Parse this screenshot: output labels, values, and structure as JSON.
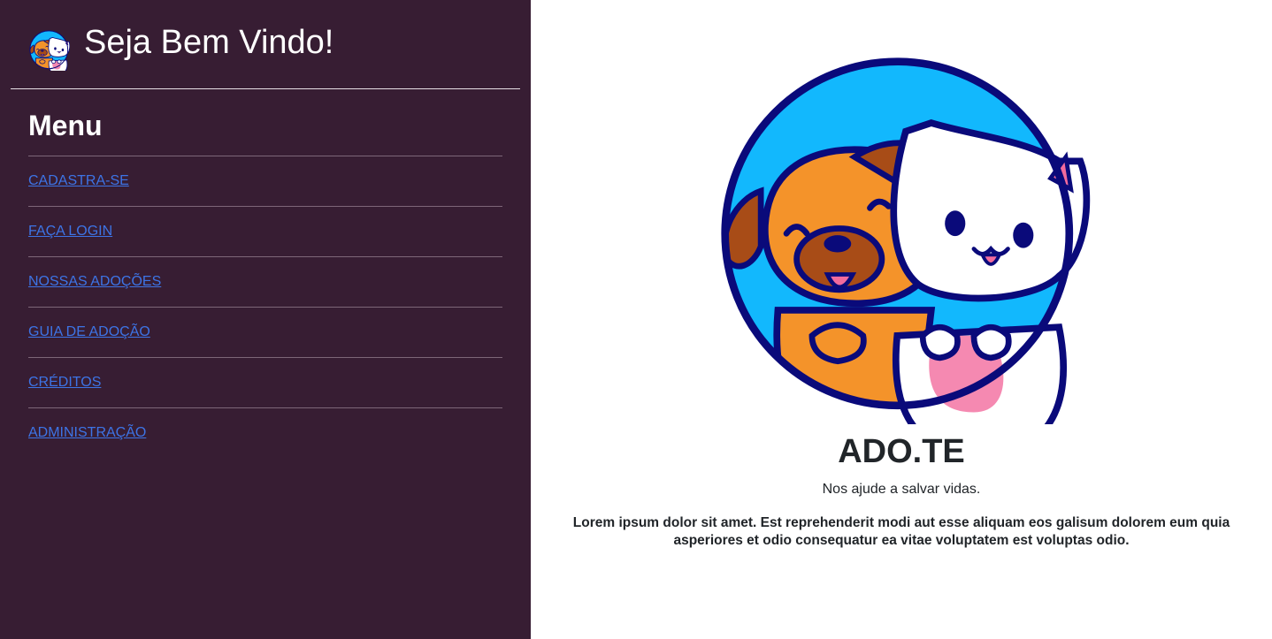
{
  "sidebar": {
    "welcome": "Seja Bem Vindo!",
    "logo_icon": "dog-cat-logo-icon",
    "menu_title": "Menu",
    "items": [
      {
        "label": "CADASTRA-SE"
      },
      {
        "label": "FAÇA LOGIN"
      },
      {
        "label": "NOSSAS ADOÇÕES"
      },
      {
        "label": "GUIA DE ADOÇÃO"
      },
      {
        "label": "CRÉDITOS"
      },
      {
        "label": "ADMINISTRAÇÃO"
      }
    ]
  },
  "main": {
    "logo_icon": "dog-cat-logo-icon",
    "brand": "ADO.TE",
    "tagline": "Nos ajude a salvar vidas.",
    "description": "Lorem ipsum dolor sit amet. Est reprehenderit modi aut esse aliquam eos galisum dolorem eum quia asperiores et odio consequatur ea vitae voluptatem est voluptas odio."
  },
  "colors": {
    "sidebar_bg": "#371d33",
    "link": "#3d74e6",
    "logo_circle": "#12b8fd",
    "logo_outline": "#0a0a7a",
    "dog": "#f4932a",
    "dog_ear": "#a84c17",
    "cat": "#ffffff",
    "tongue": "#f26b9d"
  }
}
